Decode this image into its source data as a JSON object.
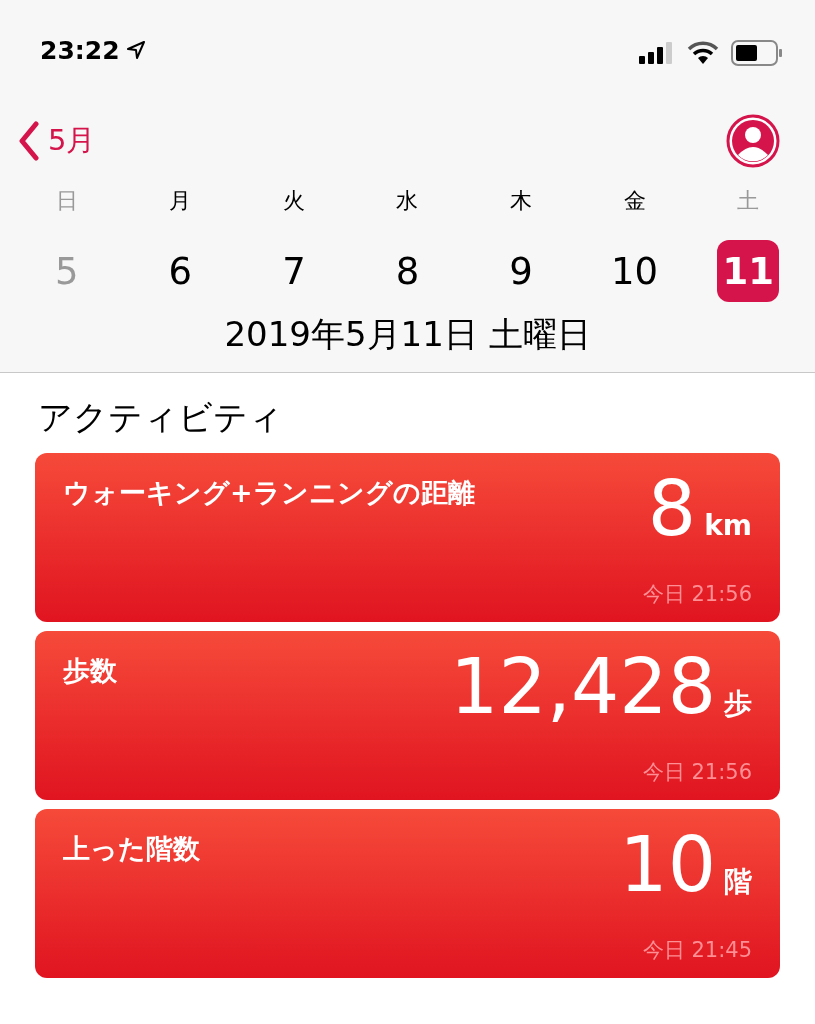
{
  "status_bar": {
    "time": "23:22"
  },
  "nav": {
    "back_label": "5月"
  },
  "week": [
    {
      "weekday": "日",
      "date": "5",
      "weekend": true,
      "muted": true,
      "selected": false
    },
    {
      "weekday": "月",
      "date": "6",
      "weekend": false,
      "muted": false,
      "selected": false
    },
    {
      "weekday": "火",
      "date": "7",
      "weekend": false,
      "muted": false,
      "selected": false
    },
    {
      "weekday": "水",
      "date": "8",
      "weekend": false,
      "muted": false,
      "selected": false
    },
    {
      "weekday": "木",
      "date": "9",
      "weekend": false,
      "muted": false,
      "selected": false
    },
    {
      "weekday": "金",
      "date": "10",
      "weekend": false,
      "muted": false,
      "selected": false
    },
    {
      "weekday": "土",
      "date": "11",
      "weekend": true,
      "muted": false,
      "selected": true
    }
  ],
  "selected_date": "2019年5月11日 土曜日",
  "section_title": "アクティビティ",
  "cards": [
    {
      "title": "ウォーキング+ランニングの距離",
      "value": "8",
      "unit": "km",
      "time": "今日 21:56"
    },
    {
      "title": "歩数",
      "value": "12,428",
      "unit": "歩",
      "time": "今日 21:56"
    },
    {
      "title": "上った階数",
      "value": "10",
      "unit": "階",
      "time": "今日 21:45"
    }
  ]
}
